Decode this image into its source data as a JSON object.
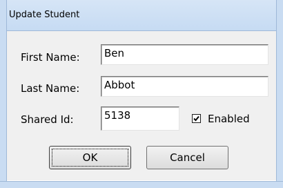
{
  "window": {
    "title": "Update Student"
  },
  "form": {
    "first_name_label": "First Name:",
    "first_name_value": "Ben",
    "last_name_label": "Last Name:",
    "last_name_value": "Abbot",
    "shared_id_label": "Shared Id:",
    "shared_id_value": "5138",
    "enabled_label": "Enabled",
    "enabled_checked": true
  },
  "buttons": {
    "ok_label": "OK",
    "cancel_label": "Cancel"
  },
  "icons": {
    "checkbox_check": "check-icon"
  }
}
